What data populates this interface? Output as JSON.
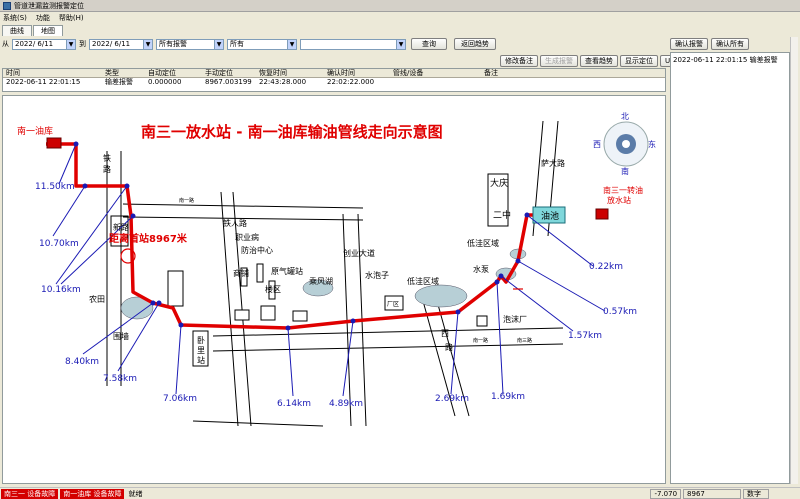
{
  "window": {
    "title": "管道泄漏监测报警定位"
  },
  "menu": {
    "items": [
      "系统(S)",
      "功能",
      "帮助(H)"
    ]
  },
  "tabs": [
    "曲线",
    "地图"
  ],
  "filter": {
    "from_label": "从",
    "from_date": "2022/ 6/11",
    "to_label": "到",
    "to_date": "2022/ 6/11",
    "alarm_type": "所有报警",
    "scope": "所有",
    "extra": "",
    "query_label": "查询",
    "back_label": "返回趋势"
  },
  "actions": [
    "修改备注",
    "生成报警",
    "查看趋势",
    "显示定位",
    "UDP上传"
  ],
  "grid": {
    "headers": [
      "时间",
      "类型",
      "自动定位",
      "手动定位",
      "恢复时间",
      "确认时间",
      "管线/设备",
      "备注"
    ],
    "rows": [
      [
        "2022-06-11 22:01:15",
        "输差报警",
        "0.000000",
        "8967.003199",
        "22:43:28.000",
        "22:02:22.000",
        "",
        ""
      ]
    ]
  },
  "map": {
    "title": "南三一放水站 - 南一油库输油管线走向示意图",
    "distance_label": "距离首站8967米",
    "start_station": "南一油库",
    "end_station": [
      "南三一转油",
      "放水站"
    ],
    "pool_label": "油池",
    "compass": {
      "n": "北",
      "s": "南",
      "e": "东",
      "w": "西"
    },
    "km_labels": [
      "11.50km",
      "10.70km",
      "10.16km",
      "8.40km",
      "7.58km",
      "7.06km",
      "6.14km",
      "4.89km",
      "2.69km",
      "1.69km",
      "1.57km",
      "0.57km",
      "0.22km"
    ],
    "place_labels": [
      "铁",
      "路",
      "南一路",
      "新路",
      "铁人路",
      "职业病",
      "防治中心",
      "商铺",
      "原气罐站",
      "楼区",
      "乘风湖",
      "创业大道",
      "水泡子",
      "厂区",
      "低洼区域",
      "大庆",
      "二中",
      "低洼区域",
      "水泵",
      "泡沫厂",
      "西",
      "路",
      "卧",
      "里",
      "站",
      "南一路",
      "南三路",
      "农田",
      "围墙",
      "萨大路"
    ]
  },
  "right_panel": {
    "confirm_label": "确认报警",
    "confirm_all_label": "确认所有",
    "list": [
      {
        "time": "2022-06-11 22:01:15",
        "type": "输差报警"
      }
    ]
  },
  "status": {
    "alarm1": "南三一 设备故障",
    "alarm2": "南一油库 设备故障",
    "ready": "就绪",
    "pos": "-7.070",
    "dist": "8967",
    "mode": "数字"
  },
  "colors": {
    "pipe": "#e00000",
    "marker": "#1a1ab4",
    "alarm_bg": "#d40000"
  }
}
